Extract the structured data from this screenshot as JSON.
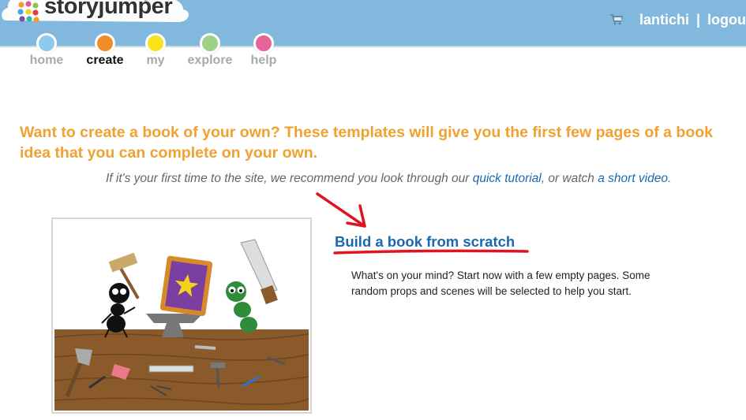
{
  "header": {
    "logo_text": "storyjumper",
    "cart_icon": "cart-icon",
    "username": "lantichi",
    "separator": "|",
    "logout": "logou"
  },
  "nav": {
    "items": [
      {
        "label": "home",
        "dot_color": "#8ec9ee",
        "active": false
      },
      {
        "label": "create",
        "dot_color": "#f28b2a",
        "active": true
      },
      {
        "label": "my",
        "dot_color": "#f7e21b",
        "active": false
      },
      {
        "label": "explore",
        "dot_color": "#9fd184",
        "active": false
      },
      {
        "label": "help",
        "dot_color": "#e8639a",
        "active": false
      }
    ]
  },
  "main": {
    "intro": "Want to create a book of your own? These templates will give you the first few pages of a book idea that you can complete on your own.",
    "tutorial": {
      "prefix": "If it's your first time to the site, we recommend you look through our ",
      "tutorial_link": "quick tutorial",
      "middle": ", or watch ",
      "video_link": "a short video",
      "suffix": "."
    },
    "build_link": "Build a book from scratch",
    "description": "What's on your mind? Start now with a few empty pages. Some random props and scenes will be selected to help you start."
  },
  "colors": {
    "header_bg": "#83b8de",
    "intro_orange": "#f0a12f",
    "link_blue": "#1a68b0",
    "annotation_red": "#e0141e"
  }
}
